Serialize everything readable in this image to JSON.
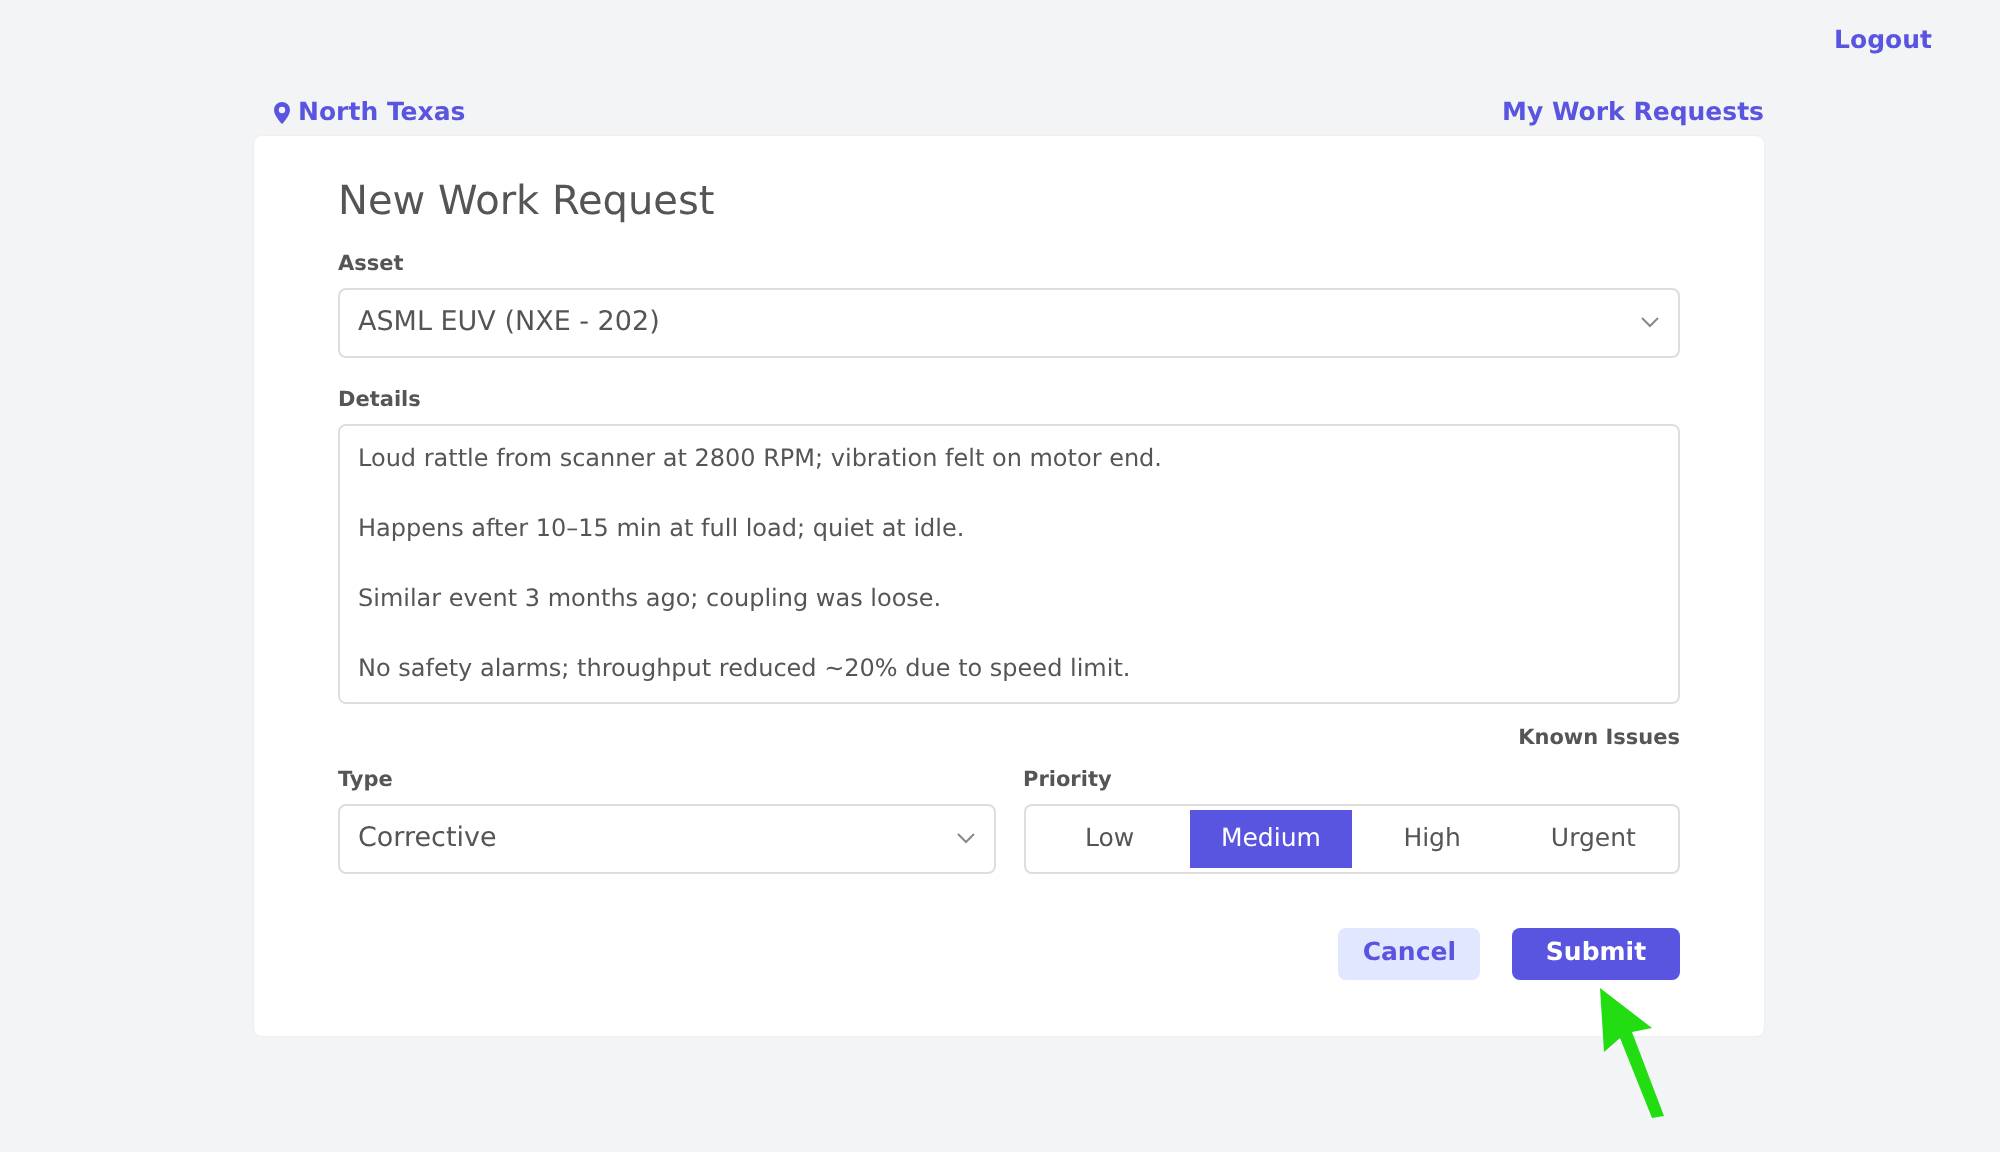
{
  "top_links": {
    "logout": "Logout",
    "location": "North Texas",
    "my_requests": "My Work Requests"
  },
  "form": {
    "title": "New Work Request",
    "asset": {
      "label": "Asset",
      "value": "ASML EUV (NXE - 202)"
    },
    "details": {
      "label": "Details",
      "value": "Loud rattle from scanner at 2800 RPM; vibration felt on motor end.\n\nHappens after 10–15 min at full load; quiet at idle.\n\nSimilar event 3 months ago; coupling was loose.\n\nNo safety alarms; throughput reduced ~20% due to speed limit."
    },
    "type": {
      "label": "Type",
      "value": "Corrective"
    },
    "priority": {
      "label": "Priority",
      "link": "Known Issues",
      "options": [
        {
          "label": "Low",
          "selected": false
        },
        {
          "label": "Medium",
          "selected": true
        },
        {
          "label": "High",
          "selected": false
        },
        {
          "label": "Urgent",
          "selected": false
        }
      ]
    },
    "buttons": [
      {
        "kind": "secondary",
        "label": "Cancel"
      },
      {
        "kind": "primary",
        "label": "Submit"
      }
    ]
  }
}
